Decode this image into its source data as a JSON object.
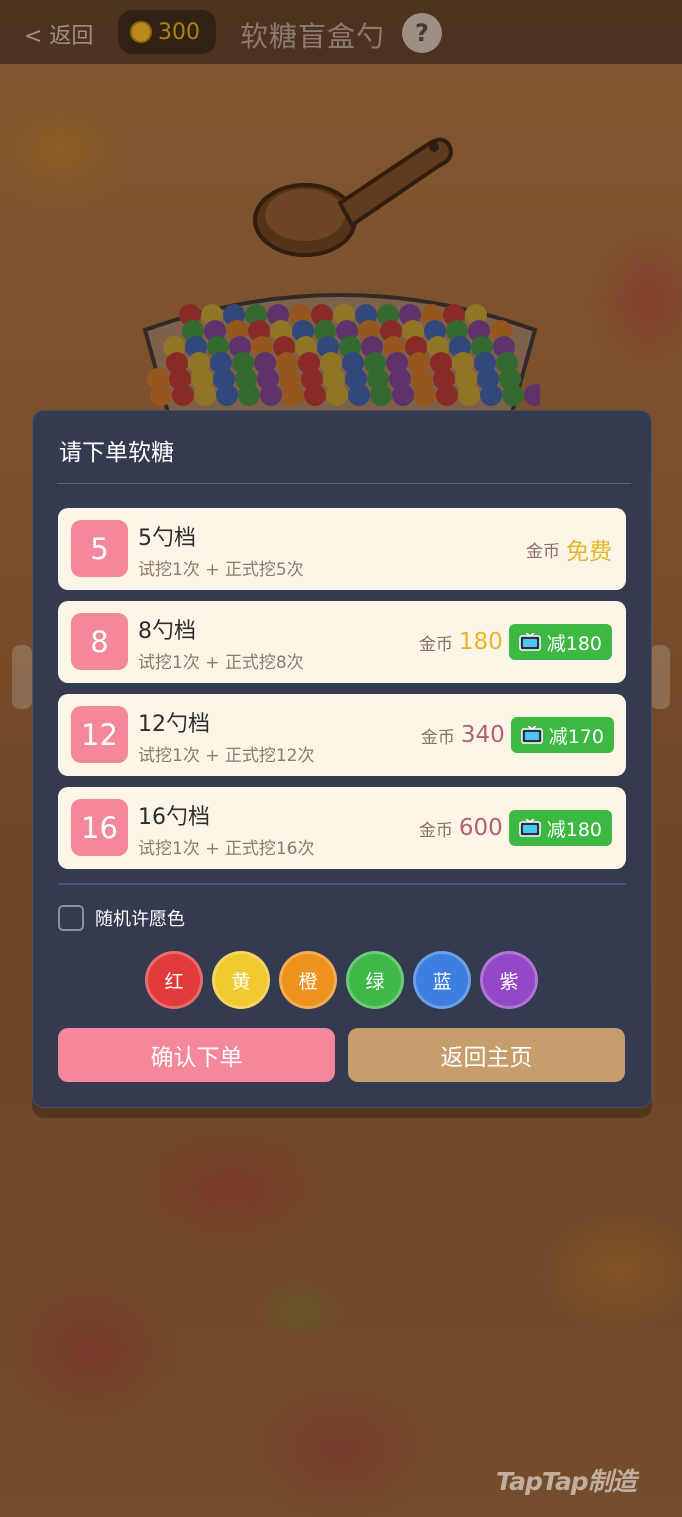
{
  "header": {
    "back_label": "< 返回",
    "coins": "300",
    "title": "软糖盲盒勺",
    "help_label": "?"
  },
  "modal": {
    "title": "请下单软糖",
    "tiers": [
      {
        "num": "5",
        "name": "5勺档",
        "desc": "试挖1次 + 正式挖5次",
        "price_label": "金币",
        "price": "免费",
        "discount": ""
      },
      {
        "num": "8",
        "name": "8勺档",
        "desc": "试挖1次 + 正式挖8次",
        "price_label": "金币",
        "price": "180",
        "discount": "减180"
      },
      {
        "num": "12",
        "name": "12勺档",
        "desc": "试挖1次 + 正式挖12次",
        "price_label": "金币",
        "price": "340",
        "discount": "减170"
      },
      {
        "num": "16",
        "name": "16勺档",
        "desc": "试挖1次 + 正式挖16次",
        "price_label": "金币",
        "price": "600",
        "discount": "减180"
      }
    ],
    "random_color_label": "随机许愿色",
    "random_color_checked": false,
    "colors": [
      {
        "label": "红",
        "hex": "#e03a3a"
      },
      {
        "label": "黄",
        "hex": "#f0c92e"
      },
      {
        "label": "橙",
        "hex": "#f0921e"
      },
      {
        "label": "绿",
        "hex": "#3fb84a"
      },
      {
        "label": "蓝",
        "hex": "#3d7fe0"
      },
      {
        "label": "紫",
        "hex": "#9448c8"
      }
    ],
    "confirm_label": "确认下单",
    "home_label": "返回主页"
  },
  "watermark": "TapTap制造"
}
